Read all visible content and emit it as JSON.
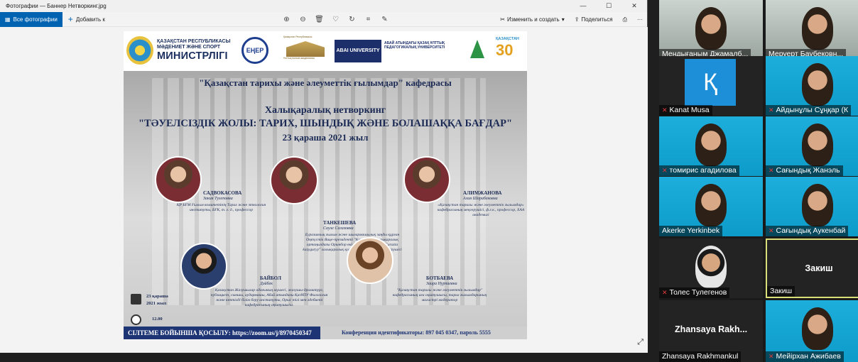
{
  "window": {
    "title": "Фотографии — Баннер Нетворкинг.jpg",
    "controls": [
      "—",
      "☐",
      "✕"
    ]
  },
  "toolbar": {
    "all_photos": "Все фотографии",
    "add_to": "Добавить к",
    "edit_create": "Изменить и создать",
    "share": "Поделиться"
  },
  "banner": {
    "ministry": {
      "line1": "ҚАЗАҚСТАН РЕСПУБЛИКАСЫ",
      "line2": "МӘДЕНИЕТ ЖӘНЕ СПОРТ",
      "line3": "МИНИСТРЛІГІ"
    },
    "ener_logo": "ЕҢЕР",
    "academy_caption": "Қазақстан Республикасы",
    "academy_caption2": "Ұлттық ғылым академиясы",
    "abai_logo": "ABAI UNIVERSITY",
    "abai_text": "АБАЙ АТЫНДАҒЫ ҚАЗАҚ ҰЛТТЫҚ ПЕДАГОГИКАЛЫҚ УНИВЕРСИТЕТІ",
    "kz30_text": "ҚАЗАҚСТАН",
    "kz30_num": "30",
    "department": "\"Қазақстан тарихы және әлеуметтік ғылымдар\" кафедрасы",
    "event_line1": "Халықаралық нетворкинг",
    "event_line2": "\"ТӘУЕЛСІЗДІК ЖОЛЫ: ТАРИХ, ШЫНДЫҚ ЖӘНЕ БОЛАШАҚҚА БАҒДАР\"",
    "event_date": "23 қараша 2021 жыл",
    "speakers": [
      {
        "name": "САДВОКАСОВА",
        "sub": "Закия Тулеповна",
        "desc": "ҚР БҒМ Ғылым комитетінің Тарих және этнология институты, БҒК, т. ғ. д., профессор"
      },
      {
        "name": "ТАНКЕШЕВА",
        "sub": "Сауле Сагазовна",
        "desc": "Еуразиялық ғылым және шығармашылық заңды құрған Оңтүстік Вице-президенті \"Қазақ тілі\" халықаралық ортаңыздағы Орынбор өкілдігінің төрағасы \"Euraziа kazyguryy\" халықаралық қоғамдастығының үйлестірушісі"
      },
      {
        "name": "АЛИМЖАНОВА",
        "sub": "Алия Шарабековна",
        "desc": "«Қазақстан тарихы және әлеуметтік ғылымдар» кафедрасының меңгерушісі, ф.ғ.к., профессор, ХАА академигі"
      },
      {
        "name": "БАЙБОЛ",
        "sub": "Дәйбек",
        "desc": "Қазақстан Жазушылар одағының мүшесі, жазушы-драматург, публицист, сыншы, аудармашы, Абай атындағы ҚазҰПУ Филология және көптілді білім беру институты, Орыс тілі мен әдебиеті кафедрасының оқытушысы."
      },
      {
        "name": "БОТБАЕВА",
        "sub": "Заира Нурпаевна",
        "desc": "\"Қазақстан тарихы және әлеуметтік ғылымдар\" кафедрасының аға оқытушысы, тарих ғылымдарының магистрі модератор"
      }
    ],
    "date_block": {
      "line1": "23 қараша",
      "line2": "2021 жыл",
      "time": "12.00"
    },
    "footer_left": "СІЛТЕМЕ БОЙЫНША ҚОСЫЛУ: https://zoom.us/j/8970450347",
    "footer_right": "Конференция идентификаторы: 897 045 0347, пароль 5555"
  },
  "participants": [
    {
      "name": "Мендығаным Джамалб...",
      "muted": false
    },
    {
      "name": "Меруерт Баубековн...",
      "muted": false
    },
    {
      "name": "Kanat Musa",
      "muted": true
    },
    {
      "name": "Айдынұлы Сұңқар (К",
      "muted": true
    },
    {
      "name": "томирис агадилова",
      "muted": true
    },
    {
      "name": "Сағындық Жанэль",
      "muted": true
    },
    {
      "name": "Akerke Yerkinbek",
      "muted": false
    },
    {
      "name": "Сағындық Аукенбай",
      "muted": true
    },
    {
      "name": "Толес Тулегенов",
      "muted": true
    },
    {
      "name": "Закиш",
      "muted": false,
      "center": "Закиш"
    },
    {
      "name": "Zhansaya Rakhmankul",
      "muted": false,
      "center": "Zhansaya  Rakh..."
    },
    {
      "name": "Мейірхан Ажибаев",
      "muted": true
    }
  ]
}
